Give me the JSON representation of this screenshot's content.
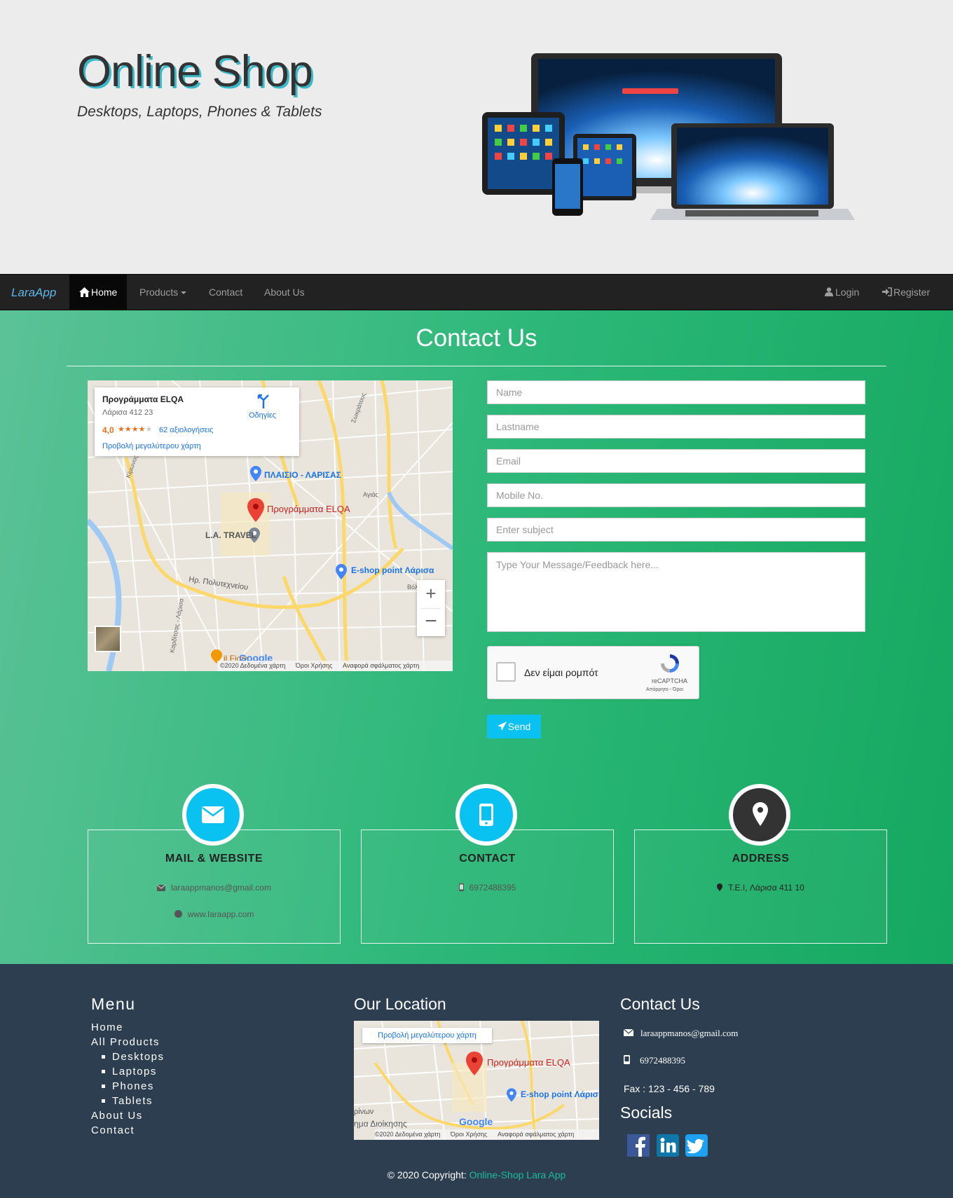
{
  "hero": {
    "title": "Online Shop",
    "subtitle": "Desktops, Laptops, Phones & Tablets"
  },
  "navbar": {
    "brand": "LaraApp",
    "home": "Home",
    "products": "Products",
    "contact": "Contact",
    "about": "About Us",
    "login": "Login",
    "register": "Register"
  },
  "contact": {
    "title": "Contact Us",
    "map": {
      "place_name": "Προγράμματα ELQA",
      "address": "Λάρισα 412 23",
      "rating": "4,0",
      "reviews": "62 αξιολογήσεις",
      "directions": "Οδηγίες",
      "larger_map": "Προβολή μεγαλύτερου χάρτη",
      "label_plaisio": "ΠΛΑΙΣΙΟ - ΛΑΡΙΣΑΣ",
      "label_marker": "Προγράμματα ELQA",
      "label_travel": "L.A. TRAVEL",
      "label_eshop": "E-shop point Λάρισα",
      "label_agias": "Αγιάς",
      "label_volou": "Βόλου",
      "label_polytexneiou": "Ηρ. Πολυτεχνείου",
      "label_fiore": "il Fiore",
      "label_kimonos": "Κίμωνος",
      "label_sokratous": "Σωκράτους",
      "label_karditsas": "Καρδίτσας - Λάρισα",
      "footer_data": "©2020 Δεδομένα χάρτη",
      "footer_terms": "Όροι Χρήσης",
      "footer_report": "Αναφορά σφάλματος χάρτη",
      "google": "Google"
    },
    "form": {
      "name_placeholder": "Name",
      "lastname_placeholder": "Lastname",
      "email_placeholder": "Email",
      "mobile_placeholder": "Mobile No.",
      "subject_placeholder": "Enter subject",
      "message_placeholder": "Type Your Message/Feedback here...",
      "recaptcha_label": "Δεν είμαι ρομπότ",
      "recaptcha_brand": "reCAPTCHA",
      "recaptcha_links": "Απόρρητο - Όροι",
      "send_label": "Send"
    },
    "boxes": [
      {
        "title": "MAIL & WEBSITE",
        "line1": "laraappmanos@gmail.com",
        "line2": "www.laraapp.com",
        "color": "#0ac2f2"
      },
      {
        "title": "CONTACT",
        "line1": "6972488395",
        "color": "#0ac2f2"
      },
      {
        "title": "ADDRESS",
        "line1": "T.E.I, Λάρισα 411 10",
        "color": "#333333"
      }
    ]
  },
  "footer": {
    "menu_title": "Menu",
    "menu": [
      "Home",
      "All Products",
      "Desktops",
      "Laptops",
      "Phones",
      "Tablets",
      "About Us",
      "Contact"
    ],
    "location_title": "Our Location",
    "small_map": {
      "larger_map": "Προβολή μεγαλύτερου χάρτη",
      "label_marker": "Προγράμματα ELQA",
      "label_eshop": "E-shop point Λάρισ",
      "label_admin": "ημα Διοίκησης",
      "label_vinon": "ρίνων",
      "footer_data": "©2020 Δεδομένα χάρτη",
      "footer_terms": "Όροι Χρήσης",
      "footer_report": "Αναφορά σφάλματος χάρτη",
      "google": "Google"
    },
    "contact_title": "Contact Us",
    "email": "laraappmanos@gmail.com",
    "phone": "6972488395",
    "fax": "Fax : 123 - 456 - 789",
    "socials_title": "Socials",
    "copyright_prefix": "© 2020 Copyright:",
    "copyright_link": "Online-Shop Lara App"
  },
  "colors": {
    "accent": "#0ac2f2",
    "brand_link": "#5fb6ea",
    "footer_bg": "#2c3e50",
    "copyright_link": "#1abc9c"
  }
}
